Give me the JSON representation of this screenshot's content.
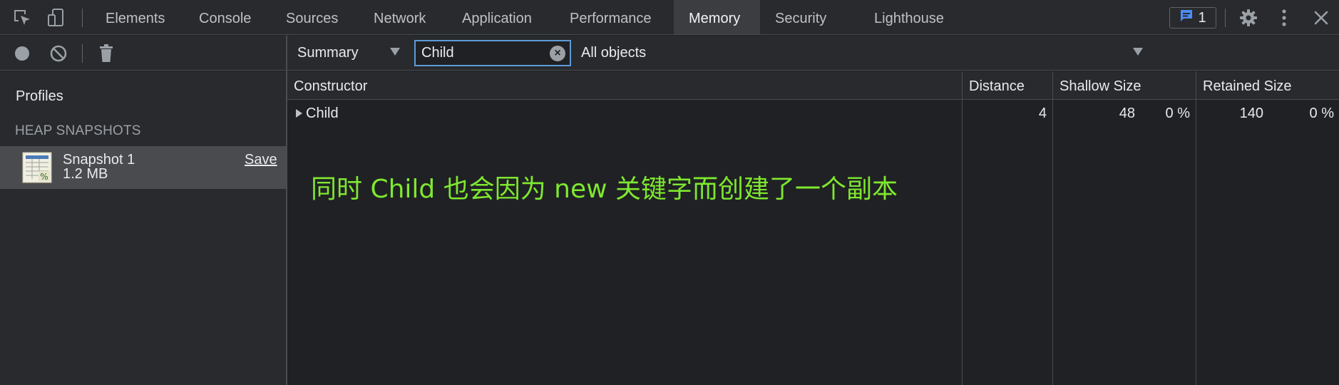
{
  "tabs": [
    {
      "label": "Elements"
    },
    {
      "label": "Console"
    },
    {
      "label": "Sources"
    },
    {
      "label": "Network"
    },
    {
      "label": "Application"
    },
    {
      "label": "Performance"
    },
    {
      "label": "Memory",
      "active": true
    },
    {
      "label": "Security"
    },
    {
      "label": "Lighthouse"
    }
  ],
  "toolbar": {
    "issues_count": "1",
    "icons": [
      "inspect-element-icon",
      "device-toolbar-icon",
      "issues-icon",
      "settings-gear-icon",
      "more-vertical-icon",
      "close-icon"
    ]
  },
  "left": {
    "toolbar_icons": [
      "record-icon",
      "clear-icon",
      "trash-icon"
    ],
    "profiles_title": "Profiles",
    "section_title": "HEAP SNAPSHOTS",
    "snapshot": {
      "name": "Snapshot 1",
      "size": "1.2 MB",
      "save_label": "Save"
    }
  },
  "filters": {
    "view_select": "Summary",
    "class_filter_value": "Child",
    "objects_select": "All objects"
  },
  "table": {
    "headers": [
      "Constructor",
      "Distance",
      "Shallow Size",
      "Retained Size"
    ],
    "rows": [
      {
        "constructor": "Child",
        "distance": "4",
        "shallow_size": "48",
        "shallow_pct": "0 %",
        "retained_size": "140",
        "retained_pct": "0 %"
      }
    ]
  },
  "annotation": "同时 Child 也会因为 new 关键字而创建了一个副本",
  "colors": {
    "background": "#202124",
    "toolbar": "#292a2d",
    "selected": "#4a4b4e",
    "accent": "#5c9bd8",
    "annotation": "#7ee82f"
  }
}
